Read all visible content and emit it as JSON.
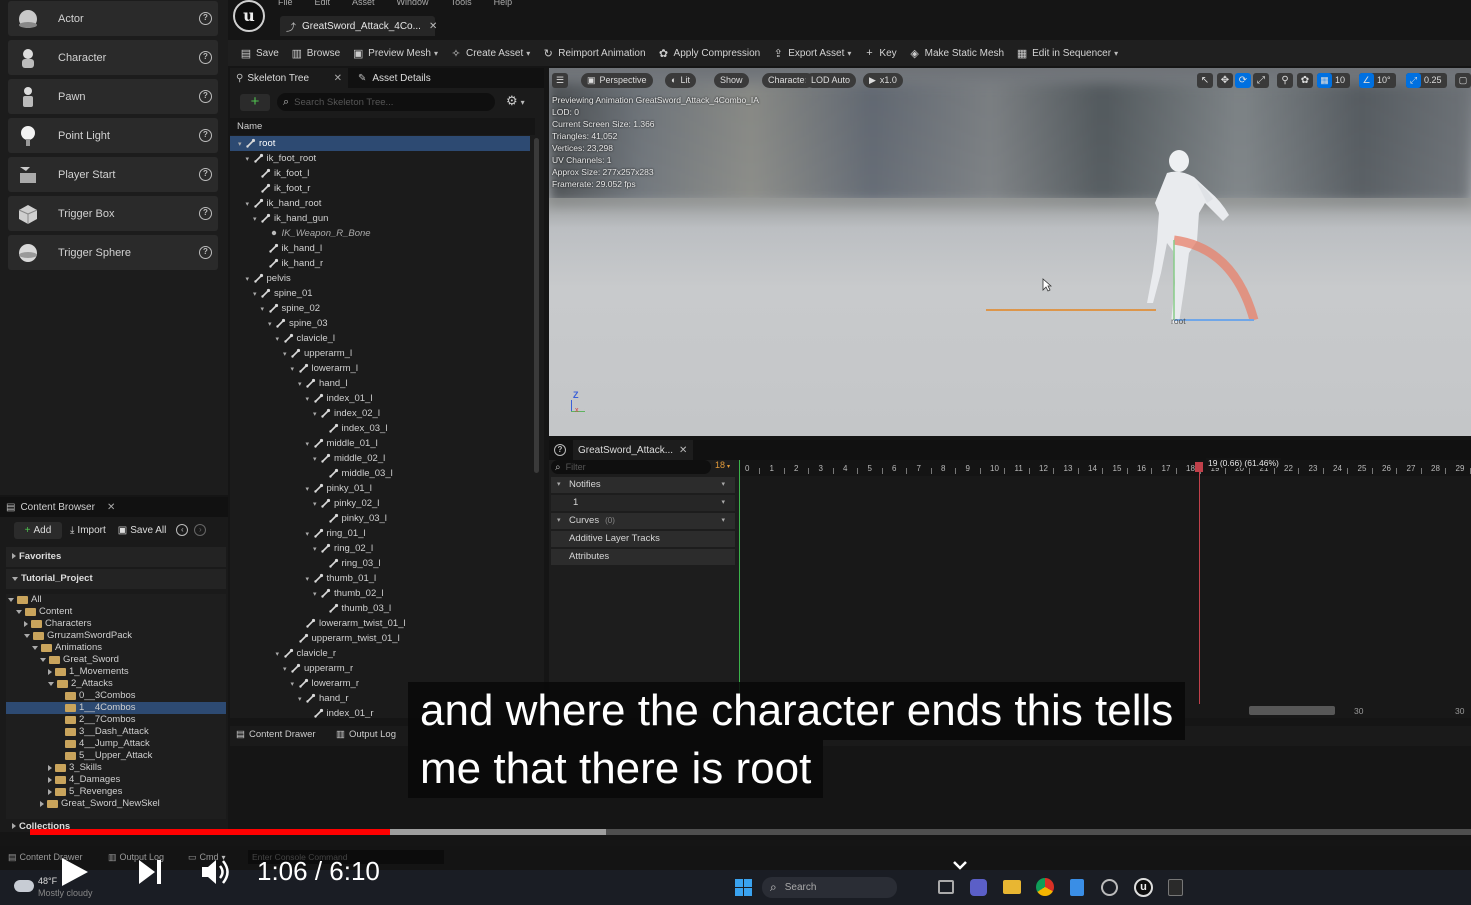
{
  "menu": [
    "File",
    "Edit",
    "Asset",
    "Window",
    "Tools",
    "Help"
  ],
  "doc_tab": {
    "title": "GreatSword_Attack_4Co..."
  },
  "toolbar": {
    "items": [
      {
        "label": "Save",
        "chevron": false
      },
      {
        "label": "Browse",
        "chevron": false
      },
      {
        "label": "Preview Mesh",
        "chevron": true
      },
      {
        "label": "Create Asset",
        "chevron": true
      },
      {
        "label": "Reimport Animation",
        "chevron": false
      },
      {
        "label": "Apply Compression",
        "chevron": false
      },
      {
        "label": "Export Asset",
        "chevron": true
      },
      {
        "label": "Key",
        "chevron": false
      },
      {
        "label": "Make Static Mesh",
        "chevron": false
      },
      {
        "label": "Edit in Sequencer",
        "chevron": true
      }
    ]
  },
  "place_actors": {
    "items": [
      "Actor",
      "Character",
      "Pawn",
      "Point Light",
      "Player Start",
      "Trigger Box",
      "Trigger Sphere"
    ]
  },
  "skeleton": {
    "tab1": "Skeleton Tree",
    "tab2": "Asset Details",
    "search_placeholder": "Search Skeleton Tree...",
    "name_header": "Name",
    "bones": [
      {
        "name": "root",
        "depth": 0,
        "sel": true
      },
      {
        "name": "ik_foot_root",
        "depth": 1
      },
      {
        "name": "ik_foot_l",
        "depth": 2
      },
      {
        "name": "ik_foot_r",
        "depth": 2
      },
      {
        "name": "ik_hand_root",
        "depth": 1
      },
      {
        "name": "ik_hand_gun",
        "depth": 2
      },
      {
        "name": "IK_Weapon_R_Bone",
        "depth": 3,
        "italic": true
      },
      {
        "name": "ik_hand_l",
        "depth": 3
      },
      {
        "name": "ik_hand_r",
        "depth": 3
      },
      {
        "name": "pelvis",
        "depth": 1
      },
      {
        "name": "spine_01",
        "depth": 2
      },
      {
        "name": "spine_02",
        "depth": 3
      },
      {
        "name": "spine_03",
        "depth": 4
      },
      {
        "name": "clavicle_l",
        "depth": 5
      },
      {
        "name": "upperarm_l",
        "depth": 6
      },
      {
        "name": "lowerarm_l",
        "depth": 7
      },
      {
        "name": "hand_l",
        "depth": 8
      },
      {
        "name": "index_01_l",
        "depth": 9
      },
      {
        "name": "index_02_l",
        "depth": 10
      },
      {
        "name": "index_03_l",
        "depth": 11
      },
      {
        "name": "middle_01_l",
        "depth": 9
      },
      {
        "name": "middle_02_l",
        "depth": 10
      },
      {
        "name": "middle_03_l",
        "depth": 11
      },
      {
        "name": "pinky_01_l",
        "depth": 9
      },
      {
        "name": "pinky_02_l",
        "depth": 10
      },
      {
        "name": "pinky_03_l",
        "depth": 11
      },
      {
        "name": "ring_01_l",
        "depth": 9
      },
      {
        "name": "ring_02_l",
        "depth": 10
      },
      {
        "name": "ring_03_l",
        "depth": 11
      },
      {
        "name": "thumb_01_l",
        "depth": 9
      },
      {
        "name": "thumb_02_l",
        "depth": 10
      },
      {
        "name": "thumb_03_l",
        "depth": 11
      },
      {
        "name": "lowerarm_twist_01_l",
        "depth": 8
      },
      {
        "name": "upperarm_twist_01_l",
        "depth": 7
      },
      {
        "name": "clavicle_r",
        "depth": 5
      },
      {
        "name": "upperarm_r",
        "depth": 6
      },
      {
        "name": "lowerarm_r",
        "depth": 7
      },
      {
        "name": "hand_r",
        "depth": 8
      },
      {
        "name": "index_01_r",
        "depth": 9
      }
    ]
  },
  "viewport": {
    "pills": [
      "Perspective",
      "Lit",
      "Show",
      "Character",
      "LOD Auto",
      "x1.0"
    ],
    "stats": [
      "Previewing Animation GreatSword_Attack_4Combo_IA",
      "LOD: 0",
      "Current Screen Size: 1.366",
      "Triangles: 41,052",
      "Vertices: 23,298",
      "UV Channels: 1",
      "Approx Size: 277x257x283",
      "Framerate: 29.052 fps"
    ],
    "right_values": [
      "10",
      "10°",
      "0.25"
    ],
    "bone_label": "root",
    "axis_z": "Z"
  },
  "anim_editor": {
    "tab": "GreatSword_Attack...",
    "filter_placeholder": "Filter",
    "frame_badge": "18",
    "tracks": [
      {
        "label": "Notifies",
        "count": ""
      },
      {
        "label": "1",
        "count": ""
      },
      {
        "label": "Curves",
        "count": "(0)"
      },
      {
        "label": "Additive Layer Tracks",
        "count": ""
      },
      {
        "label": "Attributes",
        "count": ""
      }
    ],
    "frames": [
      "0",
      "1",
      "2",
      "3",
      "4",
      "5",
      "6",
      "7",
      "8",
      "9",
      "10",
      "11",
      "12",
      "13",
      "14",
      "15",
      "16",
      "17",
      "18",
      "19",
      "20",
      "21",
      "22",
      "23",
      "24",
      "25",
      "26",
      "27",
      "28",
      "29"
    ],
    "playhead": "19 (0.66) (61.46%)",
    "end_labels": [
      "30",
      "30"
    ]
  },
  "content_browser": {
    "tab": "Content Browser",
    "add": "Add",
    "import": "Import",
    "save_all": "Save All",
    "favorites": "Favorites",
    "project": "Tutorial_Project",
    "tree": [
      {
        "name": "All",
        "depth": 0,
        "open": true
      },
      {
        "name": "Content",
        "depth": 1,
        "open": true
      },
      {
        "name": "Characters",
        "depth": 2,
        "open": false
      },
      {
        "name": "GrruzamSwordPack",
        "depth": 2,
        "open": true
      },
      {
        "name": "Animations",
        "depth": 3,
        "open": true
      },
      {
        "name": "Great_Sword",
        "depth": 4,
        "open": true
      },
      {
        "name": "1_Movements",
        "depth": 5,
        "open": false
      },
      {
        "name": "2_Attacks",
        "depth": 5,
        "open": true
      },
      {
        "name": "0__3Combos",
        "depth": 6,
        "open": false
      },
      {
        "name": "1__4Combos",
        "depth": 6,
        "open": false,
        "sel": true
      },
      {
        "name": "2__7Combos",
        "depth": 6,
        "open": false
      },
      {
        "name": "3__Dash_Attack",
        "depth": 6,
        "open": false
      },
      {
        "name": "4__Jump_Attack",
        "depth": 6,
        "open": false
      },
      {
        "name": "5__Upper_Attack",
        "depth": 6,
        "open": false
      },
      {
        "name": "3_Skills",
        "depth": 5,
        "open": false
      },
      {
        "name": "4_Damages",
        "depth": 5,
        "open": false
      },
      {
        "name": "5_Revenges",
        "depth": 5,
        "open": false
      },
      {
        "name": "Great_Sword_NewSkel",
        "depth": 4,
        "open": false
      }
    ],
    "collections": "Collections"
  },
  "drawer": {
    "content_drawer": "Content Drawer",
    "output_log": "Output Log",
    "cmd": "Cmd",
    "console_placeholder": "Enter Console Command"
  },
  "subtitle": {
    "line1": "and where the character ends this tells",
    "line2": "me that there is root"
  },
  "player": {
    "time": "1:06 / 6:10",
    "progress": 0.25,
    "buffered": 0.4
  },
  "taskbar": {
    "temp": "48°F",
    "weather": "Mostly cloudy",
    "search": "Search"
  },
  "colors": {
    "accent": "#0070e0",
    "selection": "#2d4a72",
    "folder": "#c9a45c",
    "yt_red": "#ff0000",
    "timeline_green": "#3bb24a"
  }
}
